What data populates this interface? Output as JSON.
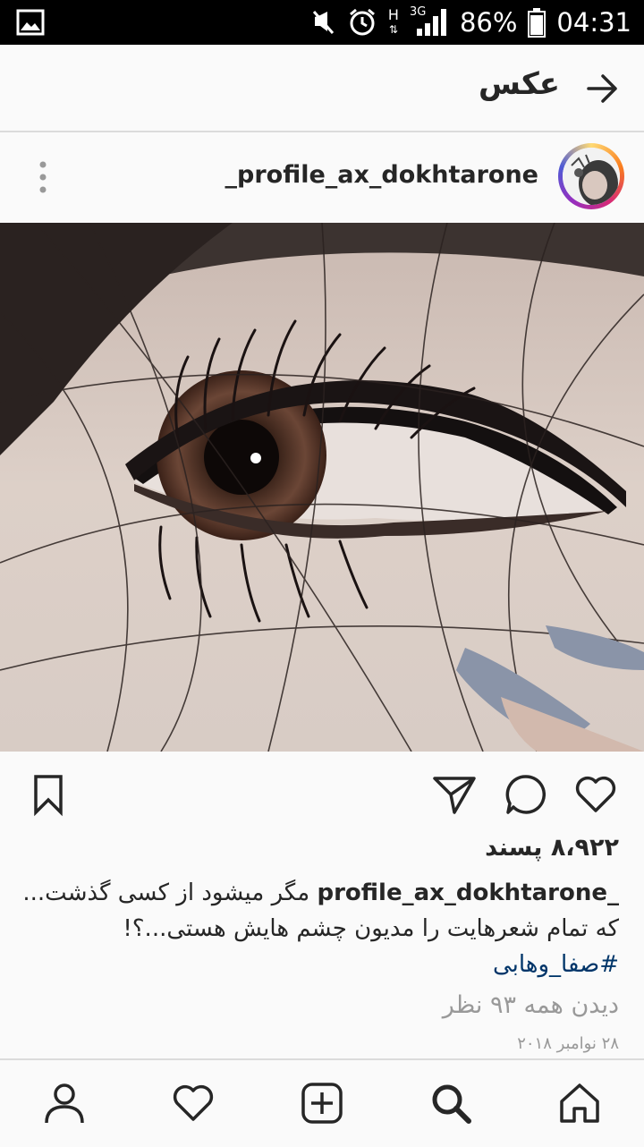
{
  "status_bar": {
    "network": "H",
    "network_type": "3G",
    "battery": "86%",
    "time": "04:31",
    "icons": [
      "gallery-icon",
      "mute-icon",
      "alarm-icon",
      "signal-icon",
      "battery-icon"
    ]
  },
  "app_bar": {
    "title": "عکس",
    "back_icon": "arrow-right-icon"
  },
  "post": {
    "username": "_profile_ax_dokhtarone",
    "likes": "۸،۹۲۲ پسند",
    "caption_user": "_profile_ax_dokhtarone",
    "caption_line1": "مگر میشود از کسی گذشت...",
    "caption_line2": "که تمام شعرهایت را مدیون چشم هایش هستی...؟!",
    "hashtag": "#صفا_وهابی",
    "view_comments": "دیدن همه ۹۳ نظر",
    "date": "۲۸ نوامبر ۲۰۱۸"
  },
  "colors": {
    "text": "#262626",
    "muted": "#999999",
    "hashtag": "#003569",
    "background": "#fafafa"
  }
}
